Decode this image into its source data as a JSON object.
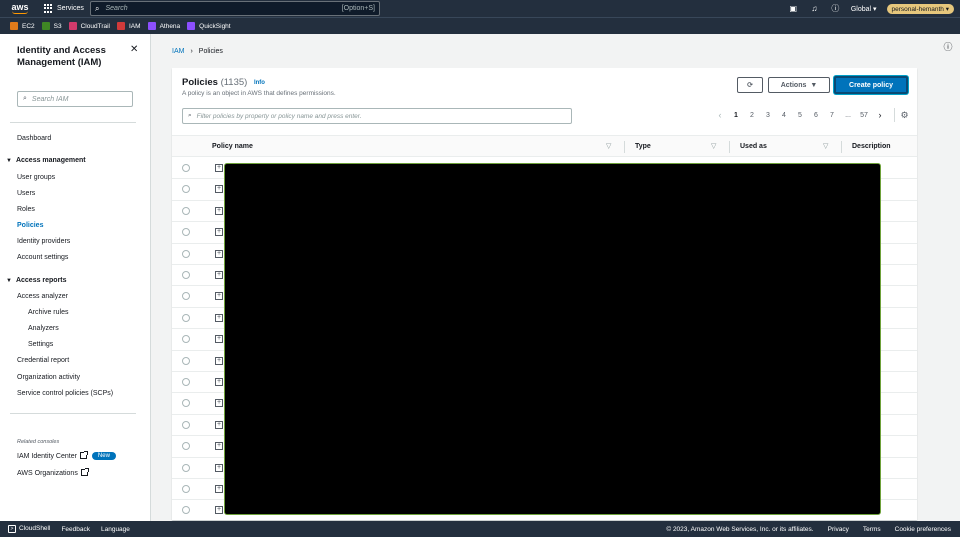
{
  "topnav": {
    "logo": "aws",
    "services_label": "Services",
    "search_placeholder": "Search",
    "search_shortcut": "[Option+S]",
    "region": "Global",
    "account": "personal-hemanth"
  },
  "favorites": [
    {
      "label": "EC2",
      "color": "#e07a1a"
    },
    {
      "label": "S3",
      "color": "#3f8624"
    },
    {
      "label": "CloudTrail",
      "color": "#d13a6b"
    },
    {
      "label": "IAM",
      "color": "#d13a3a"
    },
    {
      "label": "Athena",
      "color": "#8c4fff"
    },
    {
      "label": "QuickSight",
      "color": "#8c4fff"
    }
  ],
  "sidebar": {
    "title": "Identity and Access Management (IAM)",
    "search_placeholder": "Search IAM",
    "dashboard": "Dashboard",
    "access_management": {
      "label": "Access management",
      "items": [
        "User groups",
        "Users",
        "Roles",
        "Policies",
        "Identity providers",
        "Account settings"
      ],
      "active": "Policies"
    },
    "access_reports": {
      "label": "Access reports",
      "items": [
        "Access analyzer",
        "Archive rules",
        "Analyzers",
        "Settings",
        "Credential report",
        "Organization activity",
        "Service control policies (SCPs)"
      ]
    },
    "related_label": "Related consoles",
    "related": [
      {
        "label": "IAM Identity Center",
        "badge": "New"
      },
      {
        "label": "AWS Organizations"
      }
    ]
  },
  "breadcrumb": {
    "root": "IAM",
    "current": "Policies"
  },
  "policies": {
    "title": "Policies",
    "count": "(1135)",
    "info": "Info",
    "description": "A policy is an object in AWS that defines permissions.",
    "refresh_icon": "refresh-icon",
    "actions_label": "Actions",
    "create_label": "Create policy",
    "filter_placeholder": "Filter policies by property or policy name and press enter.",
    "pages": [
      "1",
      "2",
      "3",
      "4",
      "5",
      "6",
      "7",
      "...",
      "57"
    ],
    "current_page": "1",
    "columns": [
      "Policy name",
      "Type",
      "Used as",
      "Description"
    ],
    "row_count": 17
  },
  "footer": {
    "cloudshell": "CloudShell",
    "feedback": "Feedback",
    "language": "Language",
    "copyright": "© 2023, Amazon Web Services, Inc. or its affiliates.",
    "privacy": "Privacy",
    "terms": "Terms",
    "cookies": "Cookie preferences"
  },
  "colors": {
    "nav": "#232f3e",
    "link": "#0073bb",
    "accent": "#ff9900",
    "primary": "#0073bb"
  }
}
